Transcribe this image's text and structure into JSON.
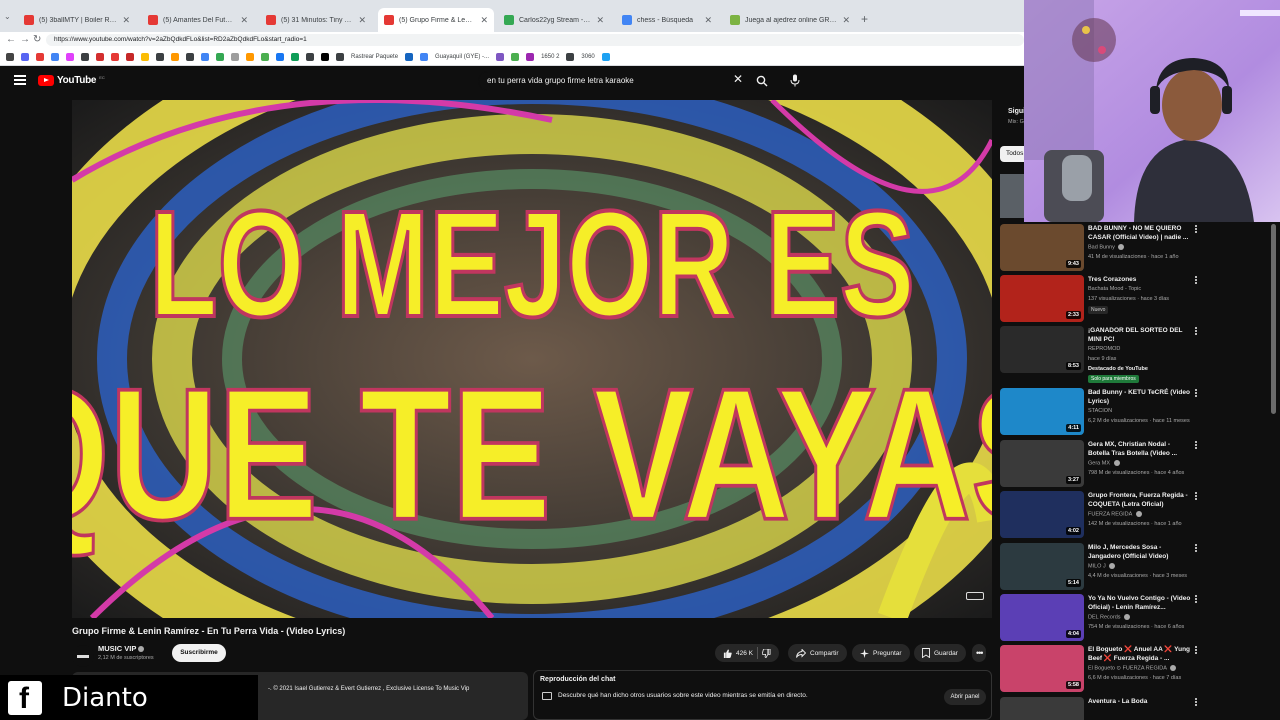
{
  "browser": {
    "tabs": [
      {
        "title": "(5) 3ballMTY | Boiler Room SYSTE",
        "favicon_color": "#e53935",
        "active": false
      },
      {
        "title": "(5) Amantes Del Futuro | Boiler Ro",
        "favicon_color": "#e53935",
        "active": false
      },
      {
        "title": "(5) 31 Minutos: Tiny Desk Concert",
        "favicon_color": "#e53935",
        "active": false
      },
      {
        "title": "(5) Grupo Firme & Lenin Ram",
        "favicon_color": "#e53935",
        "active": true
      },
      {
        "title": "Carlos22yg Stream - Watch Li",
        "favicon_color": "#34a853",
        "active": false
      },
      {
        "title": "chess - Búsqueda",
        "favicon_color": "#4285f4",
        "active": false
      },
      {
        "title": "Juega al ajedrez online GRATIS - A",
        "favicon_color": "#7cb342",
        "active": false
      }
    ],
    "url": "https://www.youtube.com/watch?v=2aZbQdkdFLo&list=RD2aZbQdkdFLo&start_radio=1",
    "bookmarks": {
      "icon_colors": [
        "#444",
        "#5865f2",
        "#e53935",
        "#4285f4",
        "#e040fb",
        "#3c4043",
        "#d32f2f",
        "#e53935",
        "#c62828",
        "#fbbc04",
        "#3c4043",
        "#ff9800",
        "#3c4043",
        "#4285f4",
        "#34a853",
        "#9e9e9e",
        "#ff9800",
        "#4caf50",
        "#1877f2",
        "#0f9d58",
        "#3c4043",
        "#000000",
        "#3c4043",
        "#1565c0",
        "#4285f4",
        "#7e57c2",
        "#4caf50",
        "#9c27b0",
        "#3c4043",
        "#1da1f2"
      ],
      "labels": [
        "Rastrear Paquete",
        "Guayaquil (GYE) -...",
        "1650 2",
        "3060"
      ]
    }
  },
  "header": {
    "logo_text": "YouTube",
    "country_code": "EC",
    "search_query": "en tu perra vida grupo firme letra karaoke"
  },
  "video": {
    "overlay_line1": "LO MEJOR ES",
    "overlay_line2": "QUE TE VAYAS",
    "title": "Grupo Firme & Lenin Ramírez - En Tu Perra Vida - (Video Lyrics)",
    "channel": "MUSIC VIP",
    "subscribers": "2,12 M de suscriptores",
    "subscribe_label": "Suscribirme",
    "likes": "426 K",
    "share_label": "Compartir",
    "ask_label": "Preguntar",
    "save_label": "Guardar",
    "description_snippet": "-. © 2021 Isael Gutierrez & Evert Gutierrez , Exclusive License To Music Vip"
  },
  "chat": {
    "title": "Reproducción del chat",
    "description": "Descubre qué han dicho otros usuarios sobre este video mientras se emitía en directo.",
    "open_label": "Abrir panel"
  },
  "sidebar": {
    "header_title": "Sigui",
    "header_sub": "Mix: G",
    "chip_label": "Todos",
    "recommendations": [
      {
        "title": "BAD BUNNY - NO ME QUIERO CASAR (Official Video) | nadie ...",
        "channel": "Bad Bunny",
        "verified": true,
        "stats": "41 M de visualizaciones · hace 1 año",
        "duration": "9:43",
        "thumb_color": "#6b4a2e"
      },
      {
        "title": "Tres Corazones",
        "channel": "Bachata Mood - Topic",
        "verified": false,
        "stats": "137 visualizaciones · hace 3 días",
        "badge": "Nuevo",
        "duration": "2:33",
        "thumb_color": "#b2231b"
      },
      {
        "title": "¡GANADOR DEL SORTEO DEL MINI PC!",
        "channel": "REPROMOD",
        "verified": false,
        "stats": "hace 9 días",
        "extra_line": "Destacado de YouTube",
        "member_badge": "Solo para miembros",
        "duration": "8:53",
        "thumb_color": "#2a2a2a"
      },
      {
        "title": "Bad Bunny - KETU TeCRÉ (Video Lyrics)",
        "channel": "STACION",
        "verified": false,
        "stats": "6,2 M de visualizaciones · hace 11 meses",
        "duration": "4:11",
        "thumb_color": "#1e88c9"
      },
      {
        "title": "Gera MX, Christian Nodal - Botella Tras Botella (Video ...",
        "channel": "Gera MX",
        "verified": true,
        "stats": "798 M de visualizaciones · hace 4 años",
        "duration": "3:27",
        "thumb_color": "#3a3a3a"
      },
      {
        "title": "Grupo Frontera, Fuerza Regida - COQUETA (Letra Oficial)",
        "channel": "FUERZA REGIDA",
        "verified": true,
        "stats": "142 M de visualizaciones · hace 1 año",
        "duration": "4:02",
        "thumb_color": "#1f2f5e"
      },
      {
        "title": "Milo J, Mercedes Sosa - Jangadero (Official Video)",
        "channel": "MILO J",
        "verified": true,
        "stats": "4,4 M de visualizaciones · hace 3 meses",
        "duration": "5:14",
        "thumb_color": "#2c3a40"
      },
      {
        "title": "Yo Ya No Vuelvo Contigo - (Video Oficial) - Lenin Ramírez...",
        "channel": "DEL Records",
        "verified": true,
        "stats": "754 M de visualizaciones · hace 6 años",
        "duration": "4:04",
        "thumb_color": "#5b3fb5"
      },
      {
        "title": "El Bogueto ❌ Anuel AA ❌ Yung Beef ❌ Fuerza Regida - ...",
        "channel": "El Bogueto ⊙ FUERZA REGIDA",
        "verified": true,
        "stats": "6,6 M de visualizaciones · hace 7 días",
        "duration": "5:58",
        "thumb_color": "#c9436a"
      },
      {
        "title": "Aventura - La Boda",
        "channel": "",
        "verified": false,
        "stats": "",
        "duration": "",
        "thumb_color": "#3a3a3a"
      }
    ]
  },
  "watermark": {
    "name": "Dianto"
  }
}
